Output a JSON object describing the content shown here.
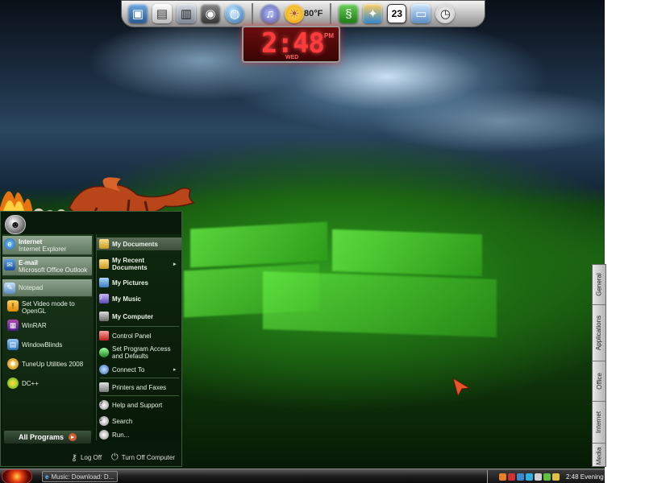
{
  "top_dock": {
    "icons": [
      "photo-frame-icon",
      "paper-icon",
      "documents-icon",
      "camera-icon",
      "globe-icon",
      "music-icon",
      "sun-icon",
      "lizard-icon",
      "network-icon",
      "calendar-icon",
      "monitor-icon",
      "clock-icon"
    ],
    "weather_temp": "80°F",
    "calendar_day": "23"
  },
  "clock": {
    "time": "2:48",
    "ampm": "PM",
    "day": "WED"
  },
  "start_menu": {
    "pinned": [
      {
        "title": "Internet",
        "subtitle": "Internet Explorer",
        "icon": "internet-explorer-icon"
      },
      {
        "title": "E-mail",
        "subtitle": "Microsoft Office Outlook",
        "icon": "outlook-icon"
      }
    ],
    "recent": [
      {
        "label": "Notepad",
        "icon": "notepad-icon",
        "highlight": true
      },
      {
        "label": "Set Video mode to OpenGL",
        "icon": "warning-icon"
      },
      {
        "label": "WinRAR",
        "icon": "winrar-icon"
      },
      {
        "label": "WindowBlinds",
        "icon": "windowblinds-icon"
      },
      {
        "label": "TuneUp Utilities 2008",
        "icon": "tuneup-icon"
      },
      {
        "label": "DC++",
        "icon": "dcpp-icon"
      }
    ],
    "all_programs": "All Programs",
    "right": [
      {
        "label": "My Documents",
        "icon": "folder-icon",
        "bold": true,
        "highlight": true
      },
      {
        "label": "My Recent Documents",
        "icon": "recent-docs-icon",
        "bold": true,
        "arrow": true
      },
      {
        "label": "My Pictures",
        "icon": "pictures-icon",
        "bold": true
      },
      {
        "label": "My Music",
        "icon": "music-folder-icon",
        "bold": true
      },
      {
        "label": "My Computer",
        "icon": "computer-icon",
        "bold": true
      },
      {
        "label": "Control Panel",
        "icon": "control-panel-icon"
      },
      {
        "label": "Set Program Access and Defaults",
        "icon": "program-access-icon"
      },
      {
        "label": "Connect To",
        "icon": "connect-icon",
        "arrow": true
      },
      {
        "label": "Printers and Faxes",
        "icon": "printer-icon"
      },
      {
        "label": "Help and Support",
        "icon": "help-icon"
      },
      {
        "label": "Search",
        "icon": "search-icon"
      },
      {
        "label": "Run...",
        "icon": "run-icon"
      }
    ],
    "log_off": "Log Off",
    "turn_off": "Turn Off Computer"
  },
  "side_tabs": [
    "General",
    "Applications",
    "Office",
    "Internet",
    "Media"
  ],
  "taskbar": {
    "task_button": "Music: Download: D...",
    "tray_clock": "2:48 Evening"
  }
}
